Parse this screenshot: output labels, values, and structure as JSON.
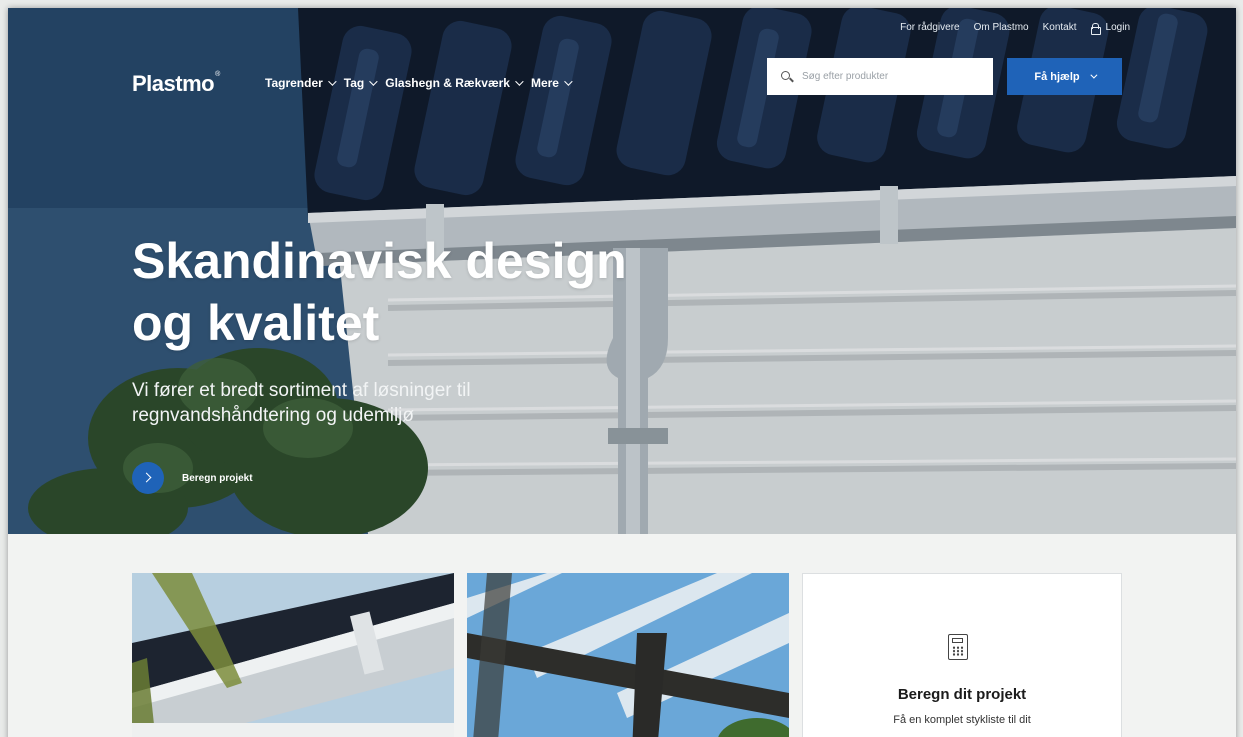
{
  "utility_nav": {
    "advisors": "For rådgivere",
    "about": "Om Plastmo",
    "contact": "Kontakt",
    "login": "Login"
  },
  "brand": {
    "logo": "Plastmo",
    "mark": "®"
  },
  "nav": {
    "items": [
      {
        "label": "Tagrender"
      },
      {
        "label": "Tag"
      },
      {
        "label": "Glashegn & Rækværk"
      },
      {
        "label": "Mere"
      }
    ]
  },
  "search": {
    "placeholder": "Søg efter produkter"
  },
  "help_button": {
    "label": "Få hjælp"
  },
  "hero": {
    "title_line1": "Skandinavisk design",
    "title_line2": "og kvalitet",
    "subtitle_line1": "Vi fører et bredt sortiment af løsninger til",
    "subtitle_line2": "regnvandshåndtering og udemiljø",
    "cta_label": "Beregn projekt"
  },
  "calculator_card": {
    "icon": "calculator-icon",
    "title": "Beregn dit projekt",
    "text": "Få en komplet stykliste til dit"
  },
  "colors": {
    "brand_blue": "#1f63b8"
  }
}
